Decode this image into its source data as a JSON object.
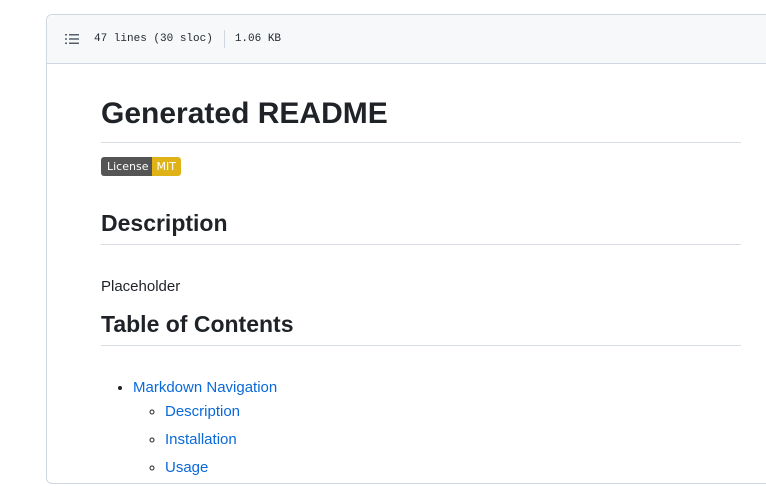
{
  "file_header": {
    "outline_icon": "list-unordered-icon",
    "lines_info": "47 lines (30 sloc)",
    "size_info": "1.06 KB"
  },
  "readme": {
    "title": "Generated README",
    "badge": {
      "label": "License",
      "value": "MIT",
      "label_color": "#555555",
      "value_color": "#dfb317"
    },
    "description_heading": "Description",
    "description_text": "Placeholder",
    "toc_heading": "Table of Contents",
    "toc": {
      "top_item": "Markdown Navigation",
      "sub_items": [
        "Description",
        "Installation",
        "Usage"
      ]
    }
  },
  "colors": {
    "link": "#0969da",
    "border": "#d0d7de",
    "header_bg": "#f6f8fa"
  }
}
